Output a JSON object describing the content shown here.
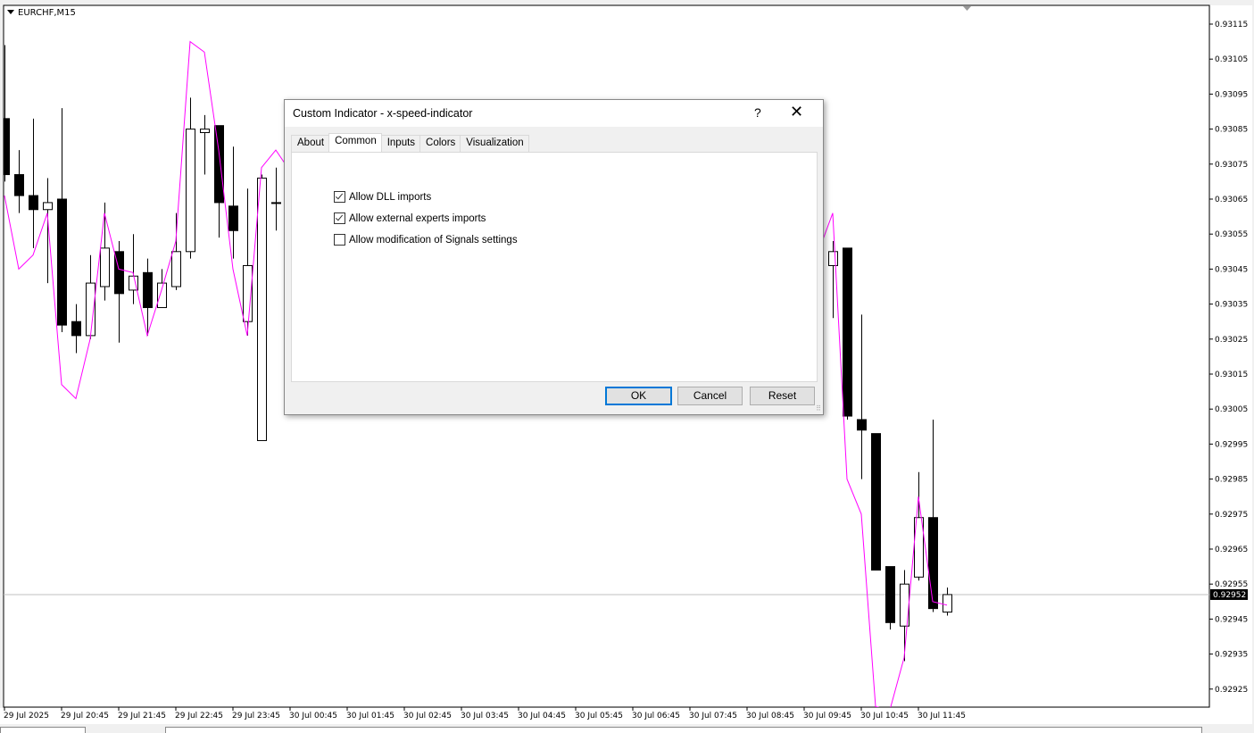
{
  "chart": {
    "symbol": "EURCHF,M15",
    "current_price": "0.92952",
    "colors": {
      "indicator": "#ff00ff",
      "bull": "#ffffff",
      "bear": "#000000",
      "price_label_bg": "#000000"
    },
    "price_ticks": [
      "0.93115",
      "0.93105",
      "0.93095",
      "0.93085",
      "0.93075",
      "0.93065",
      "0.93055",
      "0.93045",
      "0.93035",
      "0.93025",
      "0.93015",
      "0.93005",
      "0.92995",
      "0.92985",
      "0.92975",
      "0.92965",
      "0.92955",
      "0.92945",
      "0.92935",
      "0.92925"
    ],
    "time_ticks": [
      "29 Jul 2025",
      "29 Jul 20:45",
      "29 Jul 21:45",
      "29 Jul 22:45",
      "29 Jul 23:45",
      "30 Jul 00:45",
      "30 Jul 01:45",
      "30 Jul 02:45",
      "30 Jul 03:45",
      "30 Jul 04:45",
      "30 Jul 05:45",
      "30 Jul 06:45",
      "30 Jul 07:45",
      "30 Jul 08:45",
      "30 Jul 09:45",
      "30 Jul 10:45",
      "30 Jul 11:45"
    ],
    "candles": [
      {
        "i": 0,
        "o": 0.93088,
        "h": 0.93109,
        "l": 0.9307,
        "c": 0.93072
      },
      {
        "i": 1,
        "o": 0.93072,
        "h": 0.93079,
        "l": 0.93061,
        "c": 0.93066
      },
      {
        "i": 2,
        "o": 0.93066,
        "h": 0.93088,
        "l": 0.93051,
        "c": 0.93062
      },
      {
        "i": 3,
        "o": 0.93062,
        "h": 0.93071,
        "l": 0.93041,
        "c": 0.93064
      },
      {
        "i": 4,
        "o": 0.93065,
        "h": 0.93091,
        "l": 0.93027,
        "c": 0.93029
      },
      {
        "i": 5,
        "o": 0.9303,
        "h": 0.93035,
        "l": 0.93021,
        "c": 0.93026
      },
      {
        "i": 6,
        "o": 0.93026,
        "h": 0.93049,
        "l": 0.93025,
        "c": 0.93041
      },
      {
        "i": 7,
        "o": 0.9304,
        "h": 0.93064,
        "l": 0.93036,
        "c": 0.93051
      },
      {
        "i": 8,
        "o": 0.9305,
        "h": 0.93053,
        "l": 0.93024,
        "c": 0.93038
      },
      {
        "i": 9,
        "o": 0.93039,
        "h": 0.93055,
        "l": 0.93035,
        "c": 0.93043
      },
      {
        "i": 10,
        "o": 0.93044,
        "h": 0.93048,
        "l": 0.93026,
        "c": 0.93034
      },
      {
        "i": 11,
        "o": 0.93034,
        "h": 0.93045,
        "l": 0.93034,
        "c": 0.93041
      },
      {
        "i": 12,
        "o": 0.9304,
        "h": 0.93061,
        "l": 0.93039,
        "c": 0.9305
      },
      {
        "i": 13,
        "o": 0.9305,
        "h": 0.93094,
        "l": 0.93048,
        "c": 0.93085
      },
      {
        "i": 14,
        "o": 0.93084,
        "h": 0.93089,
        "l": 0.93072,
        "c": 0.93085
      },
      {
        "i": 15,
        "o": 0.93086,
        "h": 0.93086,
        "l": 0.93054,
        "c": 0.93064
      },
      {
        "i": 16,
        "o": 0.93063,
        "h": 0.9308,
        "l": 0.93048,
        "c": 0.93056
      },
      {
        "i": 17,
        "o": 0.9303,
        "h": 0.93068,
        "l": 0.93026,
        "c": 0.93046
      },
      {
        "i": 18,
        "o": 0.92996,
        "h": 0.93072,
        "l": 0.92996,
        "c": 0.93071
      },
      {
        "i": 19,
        "o": 0.93064,
        "h": 0.93074,
        "l": 0.93056,
        "c": 0.93064
      },
      {
        "i": 58,
        "o": 0.93046,
        "h": 0.93053,
        "l": 0.93031,
        "c": 0.9305
      },
      {
        "i": 59,
        "o": 0.93051,
        "h": 0.93051,
        "l": 0.93002,
        "c": 0.93003
      },
      {
        "i": 60,
        "o": 0.93002,
        "h": 0.93032,
        "l": 0.92985,
        "c": 0.92999
      },
      {
        "i": 61,
        "o": 0.92998,
        "h": 0.92998,
        "l": 0.92959,
        "c": 0.92959
      },
      {
        "i": 62,
        "o": 0.9296,
        "h": 0.9296,
        "l": 0.92942,
        "c": 0.92944
      },
      {
        "i": 63,
        "o": 0.92943,
        "h": 0.92959,
        "l": 0.92933,
        "c": 0.92955
      },
      {
        "i": 64,
        "o": 0.92957,
        "h": 0.92987,
        "l": 0.92956,
        "c": 0.92974
      },
      {
        "i": 65,
        "o": 0.92974,
        "h": 0.93002,
        "l": 0.92947,
        "c": 0.92948
      },
      {
        "i": 66,
        "o": 0.92947,
        "h": 0.92954,
        "l": 0.92946,
        "c": 0.92952
      }
    ],
    "indicator_left": [
      [
        0,
        0.93066
      ],
      [
        1,
        0.93045
      ],
      [
        2,
        0.93049
      ],
      [
        3,
        0.93061
      ],
      [
        4,
        0.93012
      ],
      [
        5,
        0.93008
      ],
      [
        6,
        0.93025
      ],
      [
        7,
        0.93061
      ],
      [
        8,
        0.93045
      ],
      [
        9,
        0.93044
      ],
      [
        10,
        0.93026
      ],
      [
        11,
        0.93039
      ],
      [
        12,
        0.93053
      ],
      [
        13,
        0.9311
      ],
      [
        14,
        0.93107
      ],
      [
        15,
        0.93079
      ],
      [
        16,
        0.93045
      ],
      [
        17,
        0.93026
      ],
      [
        18,
        0.93074
      ],
      [
        19,
        0.93079
      ],
      [
        20,
        0.93073
      ]
    ],
    "indicator_right": [
      [
        57,
        0.9305
      ],
      [
        58,
        0.93061
      ],
      [
        59,
        0.92985
      ],
      [
        60,
        0.92975
      ],
      [
        61,
        0.9292
      ],
      [
        62,
        0.92919
      ],
      [
        63,
        0.92934
      ],
      [
        64,
        0.9298
      ],
      [
        65,
        0.9295
      ],
      [
        66,
        0.92949
      ]
    ]
  },
  "dialog": {
    "title": "Custom Indicator - x-speed-indicator",
    "help": "?",
    "close": "✕",
    "tabs": [
      {
        "label": "About"
      },
      {
        "label": "Common"
      },
      {
        "label": "Inputs"
      },
      {
        "label": "Colors"
      },
      {
        "label": "Visualization"
      }
    ],
    "active_tab": "Common",
    "options": [
      {
        "label": "Allow DLL imports",
        "checked": true
      },
      {
        "label": "Allow external experts imports",
        "checked": true
      },
      {
        "label": "Allow modification of Signals settings",
        "checked": false
      }
    ],
    "buttons": {
      "ok": "OK",
      "cancel": "Cancel",
      "reset": "Reset"
    }
  }
}
